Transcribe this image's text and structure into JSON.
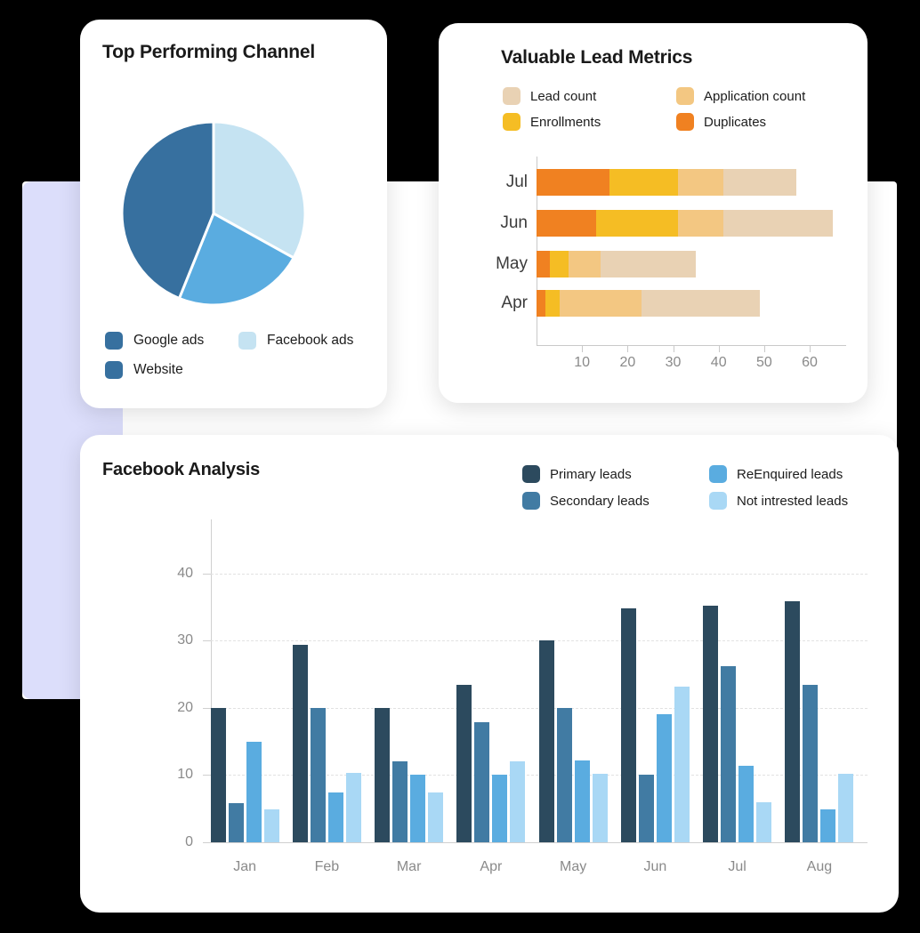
{
  "background": {
    "accent_color": "#dcdefb",
    "panel_color": "#ffffff",
    "page_color": "#000000"
  },
  "cards": {
    "channel": {
      "title": "Top Performing Channel"
    },
    "leads": {
      "title": "Valuable Lead Metrics"
    },
    "facebook": {
      "title": "Facebook Analysis"
    }
  },
  "chart_data": [
    {
      "type": "pie",
      "title": "Top Performing Channel",
      "legend_position": "bottom",
      "labels": [
        "Google ads",
        "Facebook ads",
        "Website"
      ],
      "colors": [
        "#37709F",
        "#C5E3F2",
        "#5AACE0"
      ],
      "values": [
        44,
        33,
        23
      ],
      "slices": [
        {
          "label": "Facebook ads",
          "value": 33,
          "color": "#C5E3F2",
          "start_deg": 0,
          "end_deg": 119
        },
        {
          "label": "Website",
          "value": 23,
          "color": "#5AACE0",
          "start_deg": 119,
          "end_deg": 202
        },
        {
          "label": "Google ads",
          "value": 44,
          "color": "#37709F",
          "start_deg": 202,
          "end_deg": 360
        }
      ],
      "legend": [
        {
          "label": "Google ads",
          "color": "#37709F"
        },
        {
          "label": "Facebook ads",
          "color": "#C5E3F2"
        },
        {
          "label": "Website",
          "color": "#37709F"
        }
      ]
    },
    {
      "type": "bar",
      "orientation": "horizontal",
      "stacked": true,
      "title": "Valuable Lead Metrics",
      "xlabel": "",
      "ylabel": "",
      "xlim": [
        0,
        68
      ],
      "grid": false,
      "legend_position": "top",
      "xticks": [
        10,
        20,
        30,
        40,
        50,
        60
      ],
      "categories": [
        "Jul",
        "Jun",
        "May",
        "Apr"
      ],
      "series": [
        {
          "name": "Duplicates",
          "color": "#F08121",
          "values": [
            16,
            13,
            3,
            2
          ]
        },
        {
          "name": "Enrollments",
          "color": "#F5BD24",
          "values": [
            15,
            18,
            4,
            3
          ]
        },
        {
          "name": "Application count",
          "color": "#F3C782",
          "values": [
            10,
            10,
            7,
            18
          ]
        },
        {
          "name": "Lead count",
          "color": "#E9D2B4",
          "values": [
            16,
            24,
            21,
            26
          ]
        }
      ],
      "totals": [
        57,
        65,
        35,
        49
      ],
      "legend": [
        {
          "label": "Lead count",
          "color": "#E9D2B4"
        },
        {
          "label": "Application count",
          "color": "#F3C782"
        },
        {
          "label": "Enrollments",
          "color": "#F5BD24"
        },
        {
          "label": "Duplicates",
          "color": "#F08121"
        }
      ]
    },
    {
      "type": "bar",
      "orientation": "vertical",
      "stacked": false,
      "title": "Facebook Analysis",
      "xlabel": "",
      "ylabel": "",
      "ylim": [
        0,
        48
      ],
      "yticks": [
        0,
        10,
        20,
        30,
        40
      ],
      "grid": true,
      "legend_position": "top-right",
      "categories": [
        "Jan",
        "Feb",
        "Mar",
        "Apr",
        "May",
        "Jun",
        "Jul",
        "Aug"
      ],
      "series": [
        {
          "name": "Primary leads",
          "color": "#2C4A5E",
          "values": [
            20,
            29.3,
            20,
            23.4,
            30,
            34.8,
            35.2,
            35.9
          ]
        },
        {
          "name": "Secondary leads",
          "color": "#417BA3",
          "values": [
            5.8,
            20,
            12,
            17.8,
            20,
            10,
            26.2,
            23.4
          ]
        },
        {
          "name": "ReEnquired leads",
          "color": "#5AACE0",
          "values": [
            15,
            7.4,
            10,
            10,
            12.2,
            19,
            11.4,
            4.9
          ]
        },
        {
          "name": "Not intrested leads",
          "color": "#A9D8F5",
          "values": [
            4.9,
            10.3,
            7.4,
            12,
            10.2,
            23.2,
            5.9,
            10.2
          ]
        }
      ],
      "legend": [
        {
          "label": "Primary leads",
          "color": "#2C4A5E"
        },
        {
          "label": "ReEnquired leads",
          "color": "#5AACE0"
        },
        {
          "label": "Secondary leads",
          "color": "#417BA3"
        },
        {
          "label": "Not intrested leads",
          "color": "#A9D8F5"
        }
      ]
    }
  ]
}
